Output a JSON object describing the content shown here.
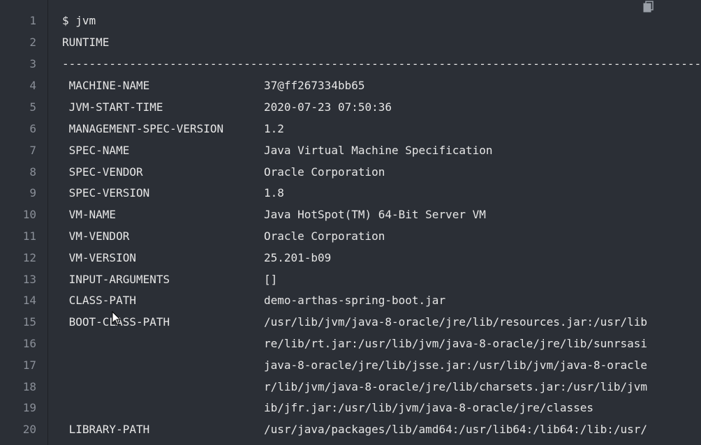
{
  "icons": {
    "copy": "copy-icon",
    "cursor": "mouse-pointer-icon"
  },
  "colors": {
    "background": "#2b2f36",
    "text": "#e6e6e6",
    "line_number": "#8a8f98"
  },
  "lines": [
    {
      "num": "1",
      "text": "$ jvm"
    },
    {
      "num": "2",
      "text": "RUNTIME"
    },
    {
      "num": "3",
      "text": "------------------------------------------------------------------------------------------------------------------------------"
    },
    {
      "num": "4",
      "text": " MACHINE-NAME                 37@ff267334bb65"
    },
    {
      "num": "5",
      "text": " JVM-START-TIME               2020-07-23 07:50:36"
    },
    {
      "num": "6",
      "text": " MANAGEMENT-SPEC-VERSION      1.2"
    },
    {
      "num": "7",
      "text": " SPEC-NAME                    Java Virtual Machine Specification"
    },
    {
      "num": "8",
      "text": " SPEC-VENDOR                  Oracle Corporation"
    },
    {
      "num": "9",
      "text": " SPEC-VERSION                 1.8"
    },
    {
      "num": "10",
      "text": " VM-NAME                      Java HotSpot(TM) 64-Bit Server VM"
    },
    {
      "num": "11",
      "text": " VM-VENDOR                    Oracle Corporation"
    },
    {
      "num": "12",
      "text": " VM-VERSION                   25.201-b09"
    },
    {
      "num": "13",
      "text": " INPUT-ARGUMENTS              []"
    },
    {
      "num": "14",
      "text": " CLASS-PATH                   demo-arthas-spring-boot.jar"
    },
    {
      "num": "15",
      "text": " BOOT-CLASS-PATH              /usr/lib/jvm/java-8-oracle/jre/lib/resources.jar:/usr/lib"
    },
    {
      "num": "16",
      "text": "                              re/lib/rt.jar:/usr/lib/jvm/java-8-oracle/jre/lib/sunrsasi"
    },
    {
      "num": "17",
      "text": "                              java-8-oracle/jre/lib/jsse.jar:/usr/lib/jvm/java-8-oracle"
    },
    {
      "num": "18",
      "text": "                              r/lib/jvm/java-8-oracle/jre/lib/charsets.jar:/usr/lib/jvm"
    },
    {
      "num": "19",
      "text": "                              ib/jfr.jar:/usr/lib/jvm/java-8-oracle/jre/classes"
    },
    {
      "num": "20",
      "text": " LIBRARY-PATH                 /usr/java/packages/lib/amd64:/usr/lib64:/lib64:/lib:/usr/"
    }
  ]
}
